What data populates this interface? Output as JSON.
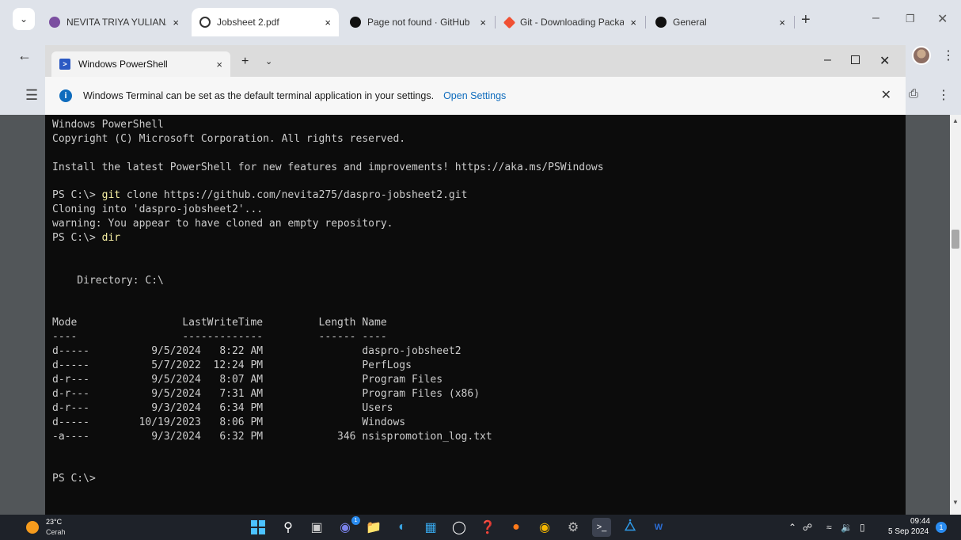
{
  "browser": {
    "tabs": [
      {
        "title": "NEVITA TRIYA YULIANA |",
        "active": false
      },
      {
        "title": "Jobsheet 2.pdf",
        "active": true
      },
      {
        "title": "Page not found · GitHub",
        "active": false
      },
      {
        "title": "Git - Downloading Packa",
        "active": false
      },
      {
        "title": "General",
        "active": false
      }
    ],
    "close_glyph": "×",
    "new_tab_glyph": "+"
  },
  "terminal": {
    "tab_title": "Windows PowerShell",
    "info_message": "Windows Terminal can be set as the default terminal application in your settings.",
    "info_link": "Open Settings",
    "lines": [
      {
        "pre": "Windows PowerShell",
        "kw": "",
        "post": ""
      },
      {
        "pre": "Copyright (C) Microsoft Corporation. All rights reserved.",
        "kw": "",
        "post": ""
      },
      {
        "pre": "",
        "kw": "",
        "post": ""
      },
      {
        "pre": "Install the latest PowerShell for new features and improvements! https://aka.ms/PSWindows",
        "kw": "",
        "post": ""
      },
      {
        "pre": "",
        "kw": "",
        "post": ""
      },
      {
        "pre": "PS C:\\> ",
        "kw": "git",
        "post": " clone https://github.com/nevita275/daspro-jobsheet2.git"
      },
      {
        "pre": "Cloning into 'daspro-jobsheet2'...",
        "kw": "",
        "post": ""
      },
      {
        "pre": "warning: You appear to have cloned an empty repository.",
        "kw": "",
        "post": ""
      },
      {
        "pre": "PS C:\\> ",
        "kw": "dir",
        "post": ""
      },
      {
        "pre": "",
        "kw": "",
        "post": ""
      },
      {
        "pre": "",
        "kw": "",
        "post": ""
      },
      {
        "pre": "    Directory: C:\\",
        "kw": "",
        "post": ""
      },
      {
        "pre": "",
        "kw": "",
        "post": ""
      },
      {
        "pre": "",
        "kw": "",
        "post": ""
      },
      {
        "pre": "Mode                 LastWriteTime         Length Name",
        "kw": "",
        "post": ""
      },
      {
        "pre": "----                 -------------         ------ ----",
        "kw": "",
        "post": ""
      },
      {
        "pre": "d-----          9/5/2024   8:22 AM                daspro-jobsheet2",
        "kw": "",
        "post": ""
      },
      {
        "pre": "d-----          5/7/2022  12:24 PM                PerfLogs",
        "kw": "",
        "post": ""
      },
      {
        "pre": "d-r---          9/5/2024   8:07 AM                Program Files",
        "kw": "",
        "post": ""
      },
      {
        "pre": "d-r---          9/5/2024   7:31 AM                Program Files (x86)",
        "kw": "",
        "post": ""
      },
      {
        "pre": "d-r---          9/3/2024   6:34 PM                Users",
        "kw": "",
        "post": ""
      },
      {
        "pre": "d-----        10/19/2023   8:06 PM                Windows",
        "kw": "",
        "post": ""
      },
      {
        "pre": "-a----          9/3/2024   6:32 PM            346 nsispromotion_log.txt",
        "kw": "",
        "post": ""
      },
      {
        "pre": "",
        "kw": "",
        "post": ""
      },
      {
        "pre": "",
        "kw": "",
        "post": ""
      },
      {
        "pre": "PS C:\\>",
        "kw": "",
        "post": ""
      }
    ]
  },
  "taskbar": {
    "weather_temp": "23°C",
    "weather_condition": "Cerah",
    "time": "09:44",
    "date": "5 Sep 2024",
    "notification_count": "1",
    "teams_badge": "1"
  },
  "colors": {
    "keyword": "#f9f1a5",
    "console_text": "#cccccc",
    "link": "#0f6cbd"
  }
}
